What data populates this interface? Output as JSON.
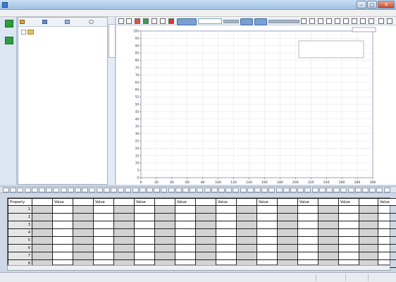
{
  "window": {
    "title": "",
    "controls": [
      "–",
      "□",
      "✕"
    ]
  },
  "menu": [
    "",
    "",
    "",
    ""
  ],
  "left_rail": [
    {
      "label": "",
      "icon": "green-box-icon"
    },
    {
      "label": "",
      "icon": "green-box-icon"
    }
  ],
  "nav_toolbar": {
    "buttons": [
      "",
      "",
      "",
      ""
    ]
  },
  "tree": {
    "root_label": ""
  },
  "splitter_tab": "",
  "chart_toolbar": {
    "zoom_value": "",
    "pill_label": ""
  },
  "chart_data": {
    "type": "line",
    "title": "",
    "legend": "",
    "xlabel": "",
    "ylabel": "",
    "xlim": [
      0,
      300
    ],
    "ylim": [
      0,
      100
    ],
    "x_ticks": [
      0,
      20,
      40,
      60,
      80,
      100,
      120,
      140,
      160,
      180,
      200,
      220,
      240,
      260,
      280,
      300
    ],
    "y_ticks": [
      0,
      5,
      10,
      15,
      20,
      25,
      30,
      35,
      40,
      45,
      50,
      55,
      60,
      65,
      70,
      75,
      80,
      85,
      90,
      95,
      100
    ],
    "series": [],
    "grid": true,
    "legend_position": "top-right"
  },
  "data_grid": {
    "header_first": "Property",
    "column_pairs": [
      {
        "name": "",
        "value": "Value"
      },
      {
        "name": "",
        "value": "Value"
      },
      {
        "name": "",
        "value": "Value"
      },
      {
        "name": "",
        "value": "Value"
      },
      {
        "name": "",
        "value": "Value"
      },
      {
        "name": "",
        "value": "Value"
      },
      {
        "name": "",
        "value": "Value"
      },
      {
        "name": "",
        "value": "Value"
      },
      {
        "name": "",
        "value": "Value"
      }
    ],
    "row_numbers": [
      "1",
      "2",
      "3",
      "4",
      "5",
      "6",
      "7",
      "8"
    ]
  },
  "status_bar": {
    "left": "",
    "segments": [
      "",
      "",
      ""
    ]
  },
  "colors": {
    "accent": "#3f6aa3",
    "grid_shade": "#d3d3d3",
    "plot_border": "#2a3fa0"
  }
}
